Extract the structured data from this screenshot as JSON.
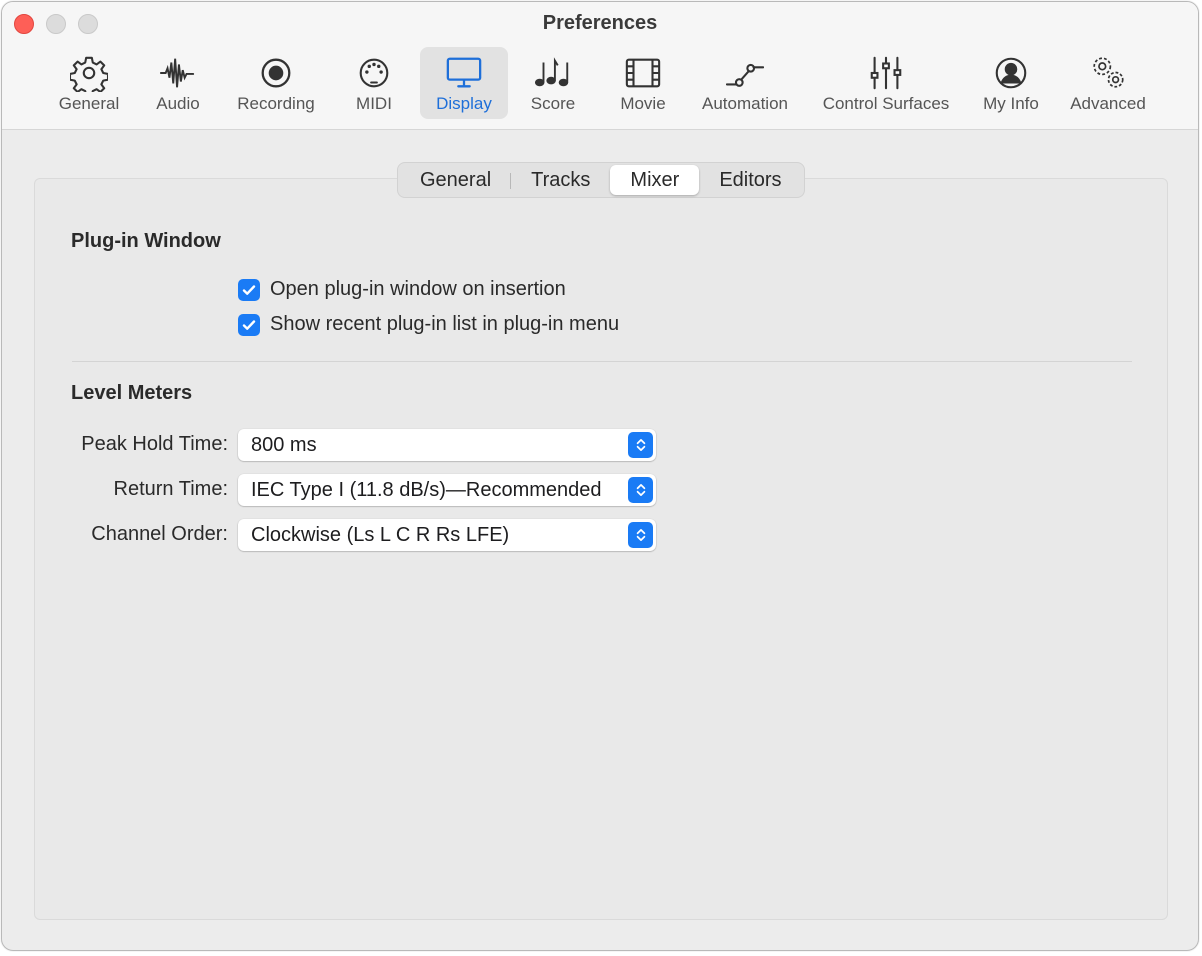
{
  "window": {
    "title": "Preferences"
  },
  "toolbar": {
    "items": [
      {
        "label": "General",
        "icon": "gear-icon"
      },
      {
        "label": "Audio",
        "icon": "waveform-icon"
      },
      {
        "label": "Recording",
        "icon": "record-icon"
      },
      {
        "label": "MIDI",
        "icon": "midi-icon"
      },
      {
        "label": "Display",
        "icon": "display-icon",
        "active": true
      },
      {
        "label": "Score",
        "icon": "music-notes-icon"
      },
      {
        "label": "Movie",
        "icon": "film-icon"
      },
      {
        "label": "Automation",
        "icon": "automation-icon"
      },
      {
        "label": "Control Surfaces",
        "icon": "sliders-icon"
      },
      {
        "label": "My Info",
        "icon": "person-icon"
      },
      {
        "label": "Advanced",
        "icon": "gears-icon"
      }
    ]
  },
  "tabs": {
    "items": [
      {
        "label": "General"
      },
      {
        "label": "Tracks"
      },
      {
        "label": "Mixer",
        "active": true
      },
      {
        "label": "Editors"
      }
    ]
  },
  "plugin_window": {
    "title": "Plug-in Window",
    "open_on_insertion": {
      "label": "Open plug-in window on insertion",
      "checked": true
    },
    "show_recent_list": {
      "label": "Show recent plug-in list in plug-in menu",
      "checked": true
    }
  },
  "level_meters": {
    "title": "Level Meters",
    "peak_hold": {
      "label": "Peak Hold Time:",
      "value": "800 ms"
    },
    "return_time": {
      "label": "Return Time:",
      "value": "IEC Type I (11.8 dB/s)—Recommended"
    },
    "channel_order": {
      "label": "Channel Order:",
      "value": "Clockwise (Ls L C R Rs LFE)"
    }
  },
  "colors": {
    "accent": "#1a7bf5",
    "close_button": "#fe5f57",
    "active_label": "#1e6fd9"
  }
}
